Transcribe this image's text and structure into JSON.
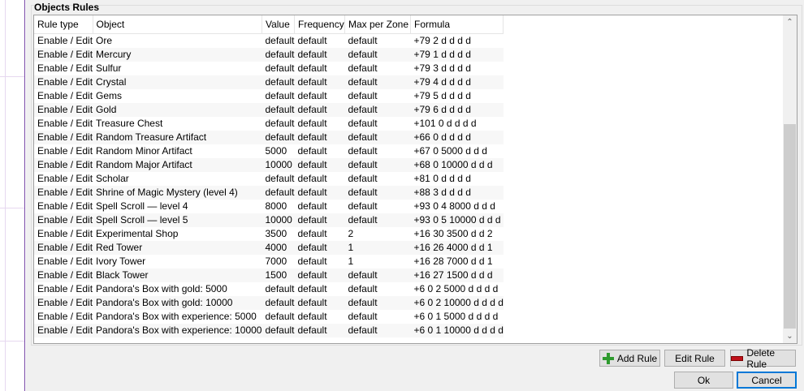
{
  "group": {
    "title": "Objects Rules"
  },
  "table": {
    "columns": [
      "Rule type",
      "Object",
      "Value",
      "Frequency",
      "Max per Zone",
      "Formula"
    ],
    "rows": [
      [
        "Enable / Edit",
        "Ore",
        "default",
        "default",
        "default",
        "+79 2 d d d d"
      ],
      [
        "Enable / Edit",
        "Mercury",
        "default",
        "default",
        "default",
        "+79 1 d d d d"
      ],
      [
        "Enable / Edit",
        "Sulfur",
        "default",
        "default",
        "default",
        "+79 3 d d d d"
      ],
      [
        "Enable / Edit",
        "Crystal",
        "default",
        "default",
        "default",
        "+79 4 d d d d"
      ],
      [
        "Enable / Edit",
        "Gems",
        "default",
        "default",
        "default",
        "+79 5 d d d d"
      ],
      [
        "Enable / Edit",
        "Gold",
        "default",
        "default",
        "default",
        "+79 6 d d d d"
      ],
      [
        "Enable / Edit",
        "Treasure Chest",
        "default",
        "default",
        "default",
        "+101 0 d d d d"
      ],
      [
        "Enable / Edit",
        "Random Treasure Artifact",
        "default",
        "default",
        "default",
        "+66 0 d d d d"
      ],
      [
        "Enable / Edit",
        "Random Minor Artifact",
        "5000",
        "default",
        "default",
        "+67 0 5000 d d d"
      ],
      [
        "Enable / Edit",
        "Random Major Artifact",
        "10000",
        "default",
        "default",
        "+68 0 10000 d d d"
      ],
      [
        "Enable / Edit",
        "Scholar",
        "default",
        "default",
        "default",
        "+81 0 d d d d"
      ],
      [
        "Enable / Edit",
        "Shrine of Magic Mystery (level 4)",
        "default",
        "default",
        "default",
        "+88 3 d d d d"
      ],
      [
        "Enable / Edit",
        "Spell Scroll — level 4",
        "8000",
        "default",
        "default",
        "+93 0 4 8000 d d d"
      ],
      [
        "Enable / Edit",
        "Spell Scroll — level 5",
        "10000",
        "default",
        "default",
        "+93 0 5 10000 d d d"
      ],
      [
        "Enable / Edit",
        "Experimental Shop",
        "3500",
        "default",
        "2",
        "+16 30 3500 d d 2"
      ],
      [
        "Enable / Edit",
        "Red Tower",
        "4000",
        "default",
        "1",
        "+16 26 4000 d d 1"
      ],
      [
        "Enable / Edit",
        "Ivory Tower",
        "7000",
        "default",
        "1",
        "+16 28 7000 d d 1"
      ],
      [
        "Enable / Edit",
        "Black Tower",
        "1500",
        "default",
        "default",
        "+16 27 1500 d d d"
      ],
      [
        "Enable / Edit",
        "Pandora's Box with gold: 5000",
        "default",
        "default",
        "default",
        "+6 0 2 5000 d d d d"
      ],
      [
        "Enable / Edit",
        "Pandora's Box with gold: 10000",
        "default",
        "default",
        "default",
        "+6 0 2 10000 d d d d"
      ],
      [
        "Enable / Edit",
        "Pandora's Box with experience: 5000",
        "default",
        "default",
        "default",
        "+6 0 1 5000 d d d d"
      ],
      [
        "Enable / Edit",
        "Pandora's Box with experience: 10000",
        "default",
        "default",
        "default",
        "+6 0 1 10000 d d d d"
      ]
    ]
  },
  "scrollbar": {
    "up_glyph": "⌃",
    "down_glyph": "⌄"
  },
  "buttons": {
    "add_rule": "Add Rule",
    "edit_rule": "Edit Rule",
    "delete_rule": "Delete Rule",
    "ok": "Ok",
    "cancel": "Cancel"
  },
  "colors": {
    "add_icon": "#2e9a2e",
    "delete_icon": "#c0101a",
    "focus_border": "#0078d7"
  }
}
